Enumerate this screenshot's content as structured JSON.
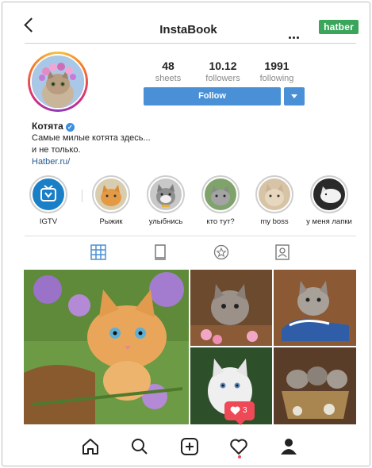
{
  "header": {
    "title": "InstaBook",
    "brand": "hatber"
  },
  "profile": {
    "stats": [
      {
        "value": "48",
        "label": "sheets"
      },
      {
        "value": "10.12",
        "label": "followers"
      },
      {
        "value": "1991",
        "label": "following"
      }
    ],
    "follow_label": "Follow",
    "name": "Котята",
    "bio_line1": "Самые милые котята здесь...",
    "bio_line2": "и не только.",
    "link": "Hatber.ru/"
  },
  "highlights": [
    {
      "label": "IGTV",
      "icon": "igtv-icon"
    },
    {
      "label": "Рыжик"
    },
    {
      "label": "улыбнись"
    },
    {
      "label": "кто тут?"
    },
    {
      "label": "my boss"
    },
    {
      "label": "у меня лапки"
    }
  ],
  "tabs": [
    "grid-icon",
    "feed-icon",
    "star-icon",
    "tagged-icon"
  ],
  "notification": {
    "count": "3"
  },
  "bottom_nav": [
    "home-icon",
    "search-icon",
    "add-icon",
    "heart-icon",
    "profile-icon"
  ],
  "colors": {
    "accent": "#4a90d6",
    "brand": "#3aa55b",
    "notification": "#ed4956"
  }
}
